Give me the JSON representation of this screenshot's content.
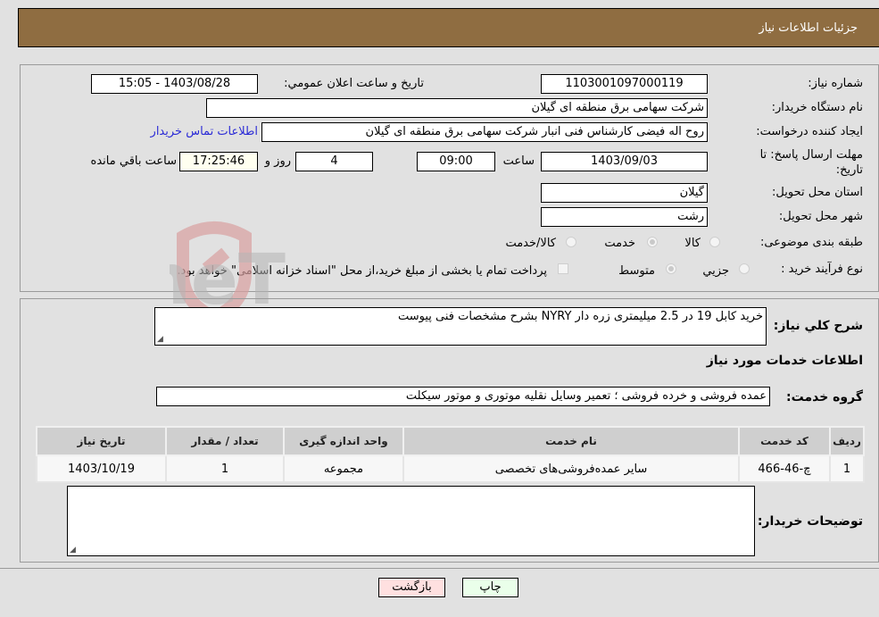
{
  "header": {
    "title": "جزئیات اطلاعات نیاز"
  },
  "form": {
    "need_number_label": "شماره نیاز:",
    "need_number": "1103001097000119",
    "announce_label": "تاریخ و ساعت اعلان عمومي:",
    "announce_value": "1403/08/28 - 15:05",
    "buyer_org_label": "نام دستگاه خریدار:",
    "buyer_org": "شرکت سهامی برق منطقه ای گیلان",
    "creator_label": "ایجاد کننده درخواست:",
    "creator": "روح اله فیضی کارشناس فنی انبار شرکت سهامی برق منطقه ای گیلان",
    "contact_link": "اطلاعات تماس خریدار",
    "deadline_label_1": "مهلت ارسال پاسخ: تا",
    "deadline_label_2": "تاریخ:",
    "deadline_date": "1403/09/03",
    "time_label": "ساعت",
    "deadline_time": "09:00",
    "days": "4",
    "days_label": "روز و",
    "remaining_time": "17:25:46",
    "remaining_label": "ساعت باقي مانده",
    "province_label": "استان محل تحویل:",
    "province": "گیلان",
    "city_label": "شهر محل تحویل:",
    "city": "رشت",
    "category_label": "طبقه بندی موضوعی:",
    "category_options": [
      {
        "label": "کالا",
        "selected": false
      },
      {
        "label": "خدمت",
        "selected": true
      },
      {
        "label": "کالا/خدمت",
        "selected": false
      }
    ],
    "process_label": "نوع فرآیند خرید :",
    "process_options": [
      {
        "label": "جزيي",
        "selected": false
      },
      {
        "label": "متوسط",
        "selected": true
      }
    ],
    "treasury_checkbox": {
      "label": "پرداخت تمام یا بخشی از مبلغ خرید،از محل \"اسناد خزانه اسلامی\" خواهد بود.",
      "checked": false
    }
  },
  "details": {
    "summary_label": "شرح كلي نیاز:",
    "summary": "خرید کابل 19 در 2.5 میلیمتری زره دار NYRY بشرح مشخصات فنی پیوست",
    "services_title": "اطلاعات خدمات مورد نیاز",
    "service_group_label": "گروه خدمت:",
    "service_group": "عمده فروشی و خرده فروشی ؛ تعمیر وسایل نقلیه موتوری و موتور سیکلت",
    "table": {
      "headers": [
        "ردیف",
        "کد خدمت",
        "نام خدمت",
        "واحد اندازه گیری",
        "تعداد / مقدار",
        "تاریخ نیاز"
      ],
      "rows": [
        [
          "1",
          "چ-46-466",
          "سایر عمده‌فروشی‌های تخصصی",
          "مجموعه",
          "1",
          "1403/10/19"
        ]
      ]
    },
    "buyer_notes_label": "توضیحات خریدار:",
    "buyer_notes": ""
  },
  "buttons": {
    "print": "چاپ",
    "back": "بازگشت"
  },
  "colors": {
    "header_bg": "#8f6d41",
    "link": "#2b2bd6",
    "print_bg": "#eaffea",
    "back_bg": "#ffe0e0"
  }
}
